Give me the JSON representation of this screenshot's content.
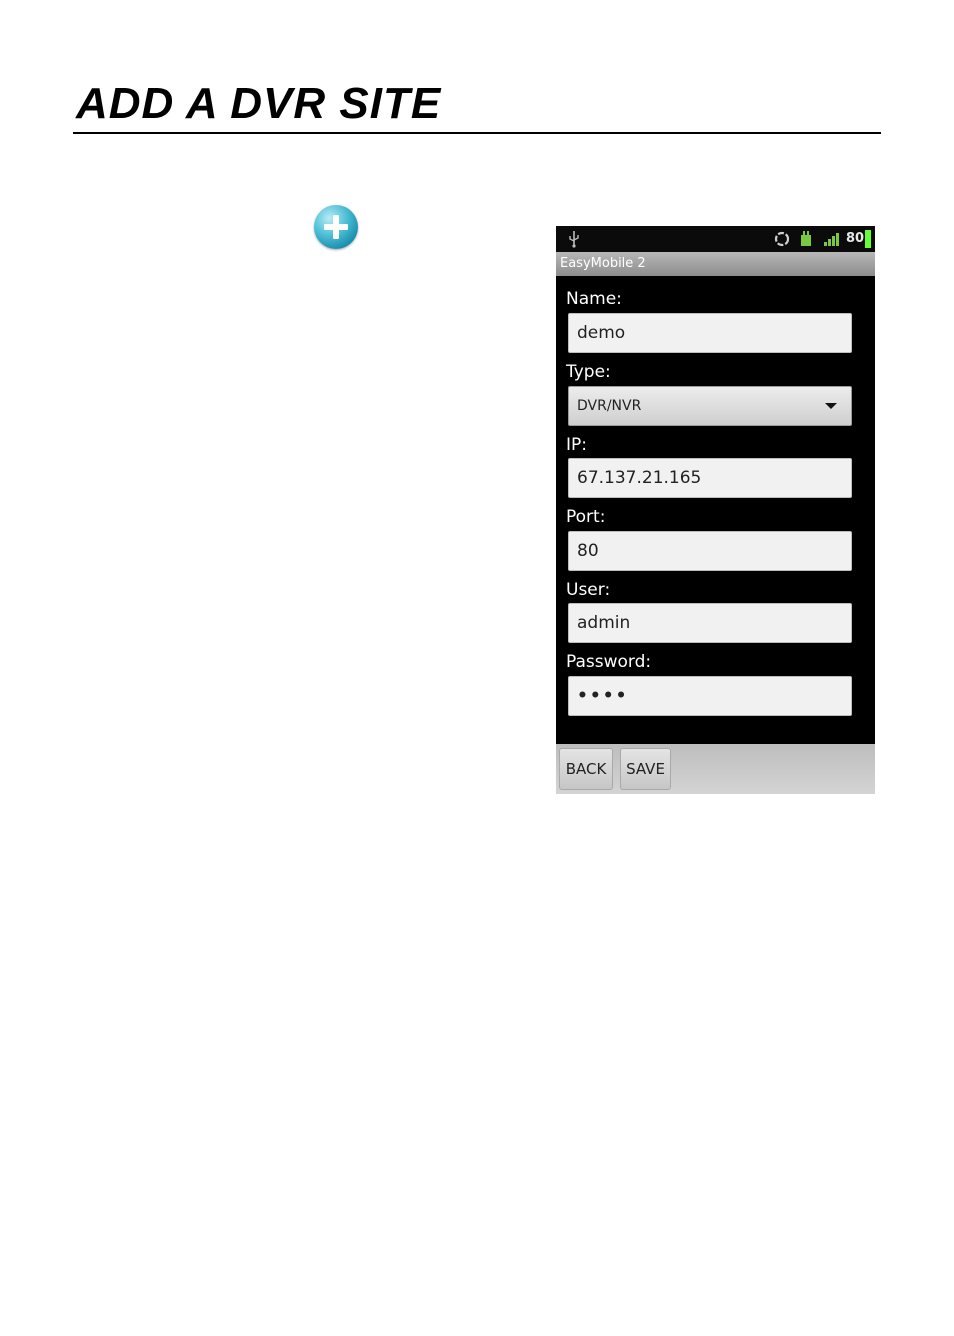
{
  "page": {
    "title": "ADD A DVR SITE",
    "add_icon": "plus-circle-icon"
  },
  "phone": {
    "status_bar": {
      "battery": "80",
      "icons": [
        "usb-icon",
        "sync-icon",
        "sim-icon",
        "signal-icon",
        "battery-icon"
      ],
      "battery_color": "#66ff33"
    },
    "app_title": "EasyMobile 2",
    "form": {
      "name_label": "Name:",
      "name_value": "demo",
      "type_label": "Type:",
      "type_value": "DVR/NVR",
      "ip_label": "IP:",
      "ip_value": "67.137.21.165",
      "port_label": "Port:",
      "port_value": "80",
      "user_label": "User:",
      "user_value": "admin",
      "password_label": "Password:",
      "password_value": "••••"
    },
    "buttons": {
      "back": "BACK",
      "save": "SAVE"
    }
  }
}
